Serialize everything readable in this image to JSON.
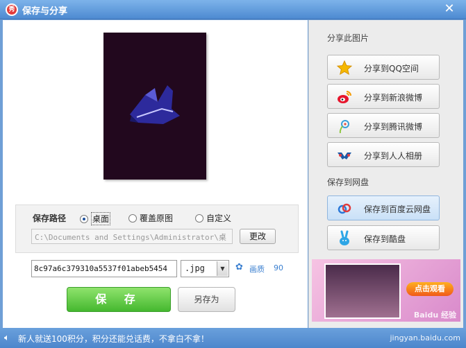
{
  "window": {
    "title": "保存与分享",
    "logo_text": "秀",
    "close_glyph": "✕"
  },
  "save_path": {
    "label": "保存路径",
    "options": [
      "桌面",
      "覆盖原图",
      "自定义"
    ],
    "selected": "桌面",
    "path_value": "C:\\Documents and Settings\\Administrator\\桌",
    "change_label": "更改"
  },
  "file": {
    "name": "8c97a6c379310a5537f01abeb5454",
    "extension": ".jpg",
    "quality_label": "画质",
    "quality_value": "90"
  },
  "actions": {
    "save_label": "保 存",
    "save_as_label": "另存为"
  },
  "share": {
    "section_title": "分享此图片",
    "items": [
      "分享到QQ空间",
      "分享到新浪微博",
      "分享到腾讯微博",
      "分享到人人相册"
    ]
  },
  "cloud": {
    "section_title": "保存到网盘",
    "items": [
      "保存到百度云网盘",
      "保存到酷盘"
    ]
  },
  "ad": {
    "button_label": "点击观看",
    "watermark": "Baidu 经验"
  },
  "status": {
    "text": "新人就送100积分，积分还能兑话费，不拿白不拿！",
    "watermark": "jingyan.baidu.com"
  }
}
